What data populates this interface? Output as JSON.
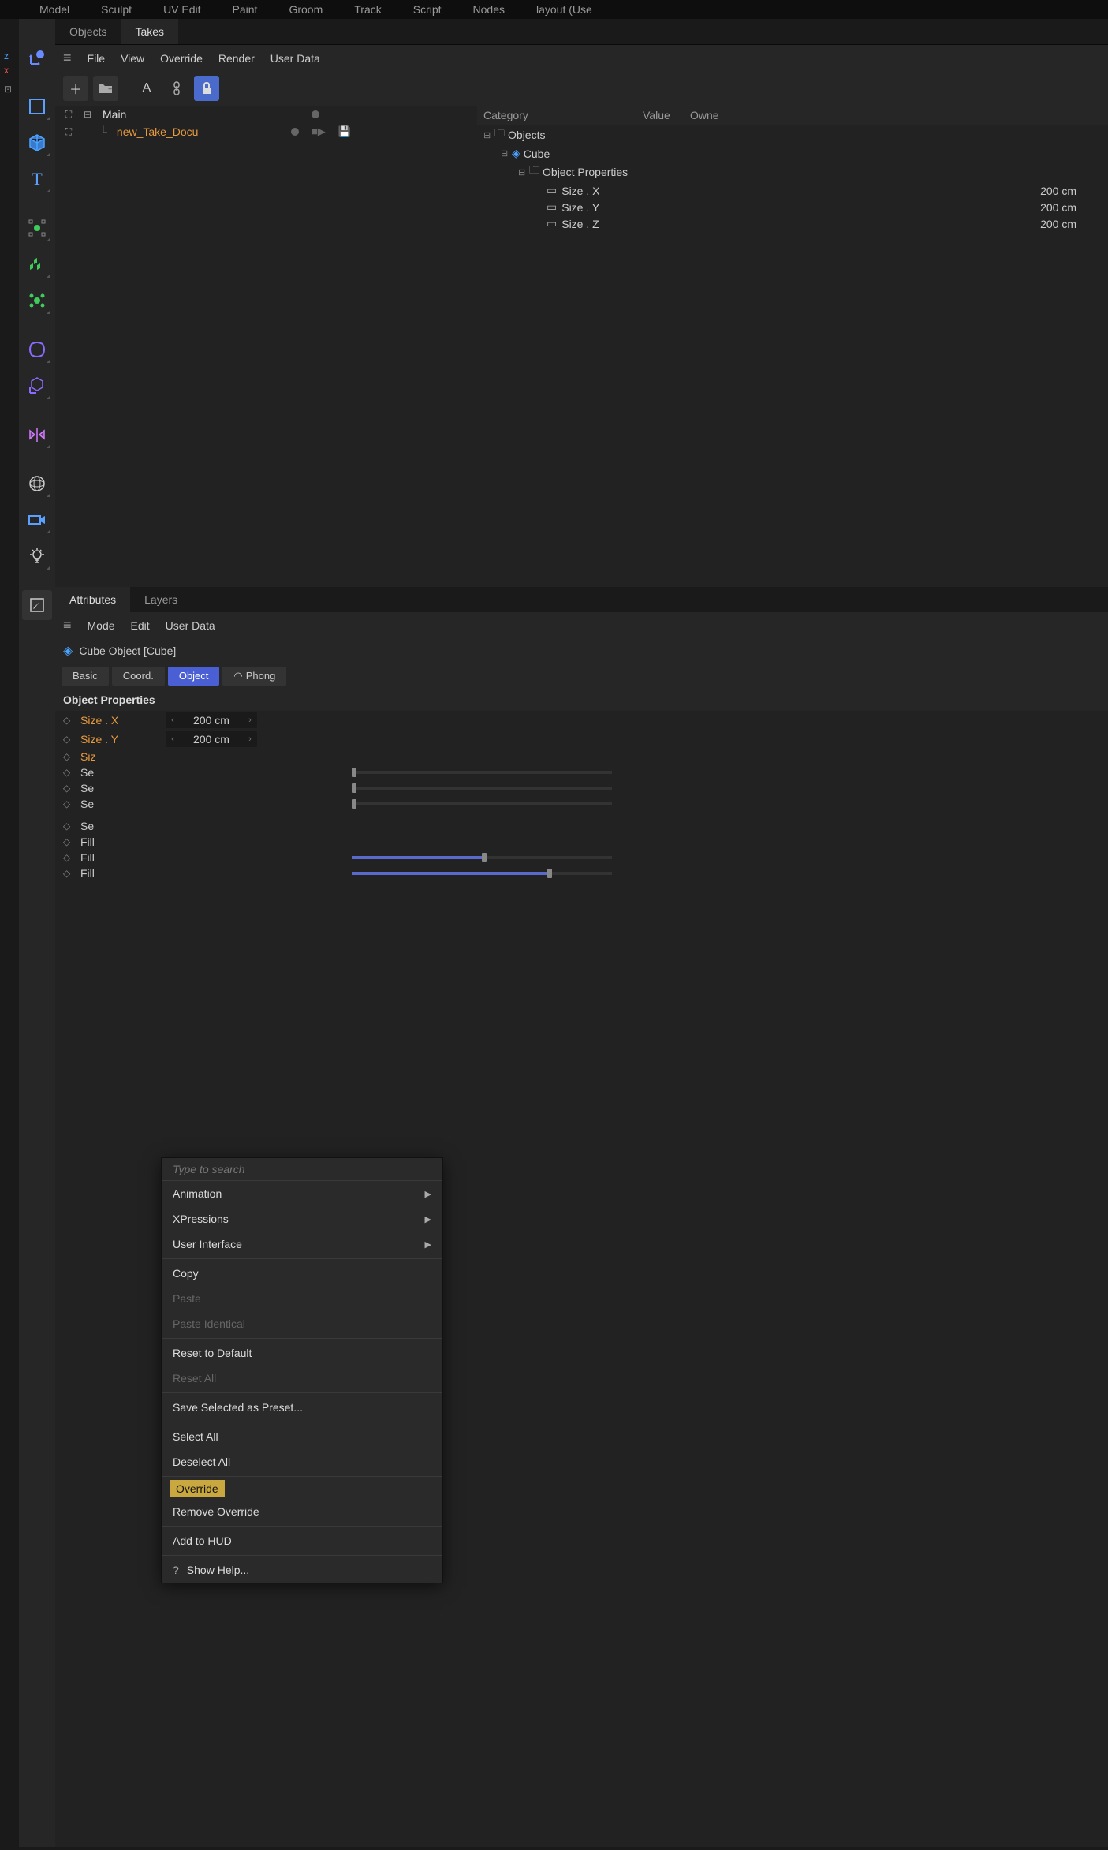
{
  "topbar": [
    "Model",
    "Sculpt",
    "UV Edit",
    "Paint",
    "Groom",
    "Track",
    "Script",
    "Nodes",
    "layout (Use"
  ],
  "tabs1": {
    "objects": "Objects",
    "takes": "Takes"
  },
  "menubar": [
    "File",
    "View",
    "Override",
    "Render",
    "User Data"
  ],
  "tree": {
    "main": "Main",
    "take": "new_Take_Docu"
  },
  "cathdr": {
    "c1": "Category",
    "c2": "Value",
    "c3": "Owne"
  },
  "cat": {
    "objects": "Objects",
    "cube": "Cube",
    "objprops": "Object Properties",
    "sx": "Size . X",
    "sy": "Size . Y",
    "sz": "Size . Z",
    "v": "200 cm"
  },
  "tabs2": {
    "attrs": "Attributes",
    "layers": "Layers"
  },
  "menubar2": [
    "Mode",
    "Edit",
    "User Data"
  ],
  "objtitle": "Cube Object [Cube]",
  "subtabs": {
    "basic": "Basic",
    "coord": "Coord.",
    "object": "Object",
    "phong": "Phong"
  },
  "sechdr": "Object Properties",
  "props": {
    "sx": "Size . X",
    "sy": "Size . Y",
    "sz": "Siz",
    "se1": "Se",
    "se2": "Se",
    "se3": "Se",
    "se4": "Se",
    "f1": "Fill",
    "f2": "Fill",
    "f3": "Fill",
    "val": "200 cm"
  },
  "ctx": {
    "search": "Type to search",
    "anim": "Animation",
    "xp": "XPressions",
    "ui": "User Interface",
    "copy": "Copy",
    "paste": "Paste",
    "pid": "Paste Identical",
    "reset": "Reset to Default",
    "resetall": "Reset All",
    "save": "Save Selected as Preset...",
    "selall": "Select All",
    "desel": "Deselect All",
    "ovr": "Override",
    "rmovr": "Remove Override",
    "hud": "Add to HUD",
    "help": "Show Help..."
  }
}
